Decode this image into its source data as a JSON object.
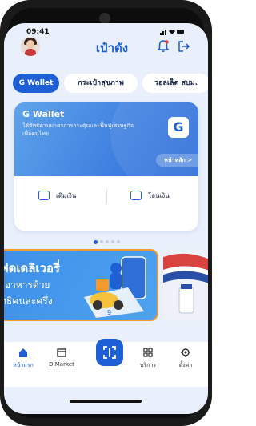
{
  "status": {
    "time": "09:41",
    "indicators": "..ıl ᯤ ▬"
  },
  "header": {
    "title": "เป๋าตัง",
    "bell_icon": "bell-icon",
    "logout_icon": "logout-icon"
  },
  "tabs": [
    {
      "label": "G Wallet"
    },
    {
      "label": "กระเป๋าสุขภาพ"
    },
    {
      "label": "วอลเล็ต สบม."
    }
  ],
  "wallet_card": {
    "name": "G Wallet",
    "description": "ใช้สิทธิตามมาตรการกระตุ้นและฟื้นฟูเศรษฐกิจ เพื่อคนไทย",
    "logo_letter": "G",
    "home_label": "หน้าหลัก  >",
    "topup_label": "เติมเงิน",
    "transfer_label": "โอนเงิน",
    "accent": "#1f5fd6"
  },
  "carousel": {
    "page_count": 5,
    "active_index": 0
  },
  "banner": {
    "line1": "ฟดเดลิเวอรี่",
    "line2": "งอาหารด้วย",
    "line3": "ทธิคนละครึ่ง",
    "border_color": "#f29a2e"
  },
  "bottom_nav": [
    {
      "label": "หน้าแรก",
      "icon": "home-icon"
    },
    {
      "label": "D Market",
      "icon": "market-icon"
    },
    {
      "label": "",
      "icon": "scan-icon"
    },
    {
      "label": "บริการ",
      "icon": "services-icon"
    },
    {
      "label": "ตั้งค่า",
      "icon": "gear-icon"
    }
  ]
}
